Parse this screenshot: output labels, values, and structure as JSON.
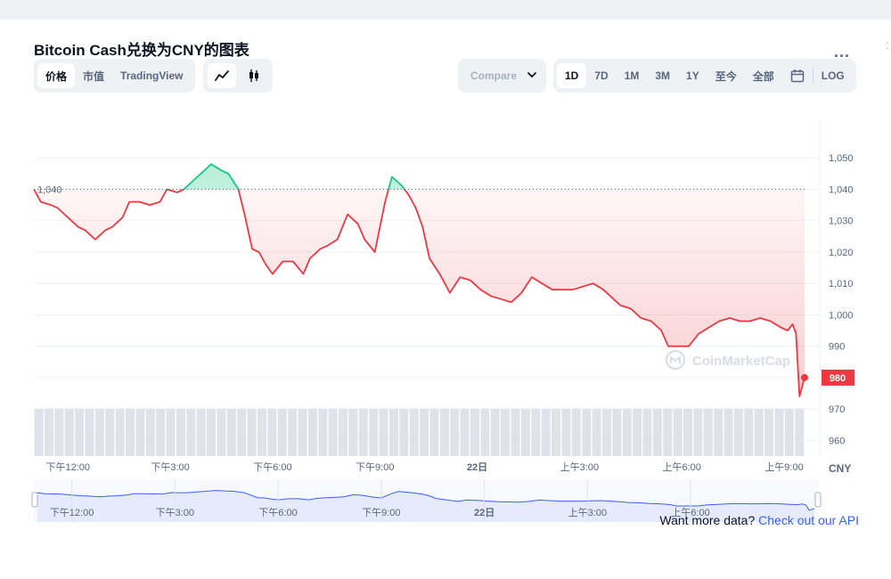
{
  "header": {
    "title": "Bitcoin Cash兑换为CNY的图表",
    "more_label": "..."
  },
  "view_tabs": [
    {
      "label": "价格",
      "active": true
    },
    {
      "label": "市值",
      "active": false
    },
    {
      "label": "TradingView",
      "active": false
    }
  ],
  "chart_type_icons": [
    {
      "icon": "line-chart-icon",
      "active": true
    },
    {
      "icon": "candlestick-icon",
      "active": false
    }
  ],
  "compare": {
    "label": "Compare with"
  },
  "range_tabs": [
    {
      "label": "1D",
      "active": true
    },
    {
      "label": "7D",
      "active": false
    },
    {
      "label": "1M",
      "active": false
    },
    {
      "label": "3M",
      "active": false
    },
    {
      "label": "1Y",
      "active": false
    },
    {
      "label": "至今",
      "active": false
    },
    {
      "label": "全部",
      "active": false
    },
    {
      "label": "",
      "icon": "calendar-icon",
      "active": false
    },
    {
      "label": "LOG",
      "active": false
    }
  ],
  "footer": {
    "prompt": "Want more data?",
    "link": "Check out our API"
  },
  "watermark": "CoinMarketCap",
  "colors": {
    "up": "#16c784",
    "down": "#ea3943",
    "navigator_fill": "#e6ebfb",
    "navigator_line": "#3861fb"
  },
  "chart_data": {
    "type": "line",
    "baseline": 1040,
    "baseline_label": "1,040",
    "current_value": 980,
    "current_label": "980",
    "currency": "CNY",
    "ylim": [
      955,
      1060
    ],
    "y_ticks": [
      {
        "value": 1050,
        "label": "1,050"
      },
      {
        "value": 1040,
        "label": "1,040"
      },
      {
        "value": 1030,
        "label": "1,030"
      },
      {
        "value": 1020,
        "label": "1,020"
      },
      {
        "value": 1010,
        "label": "1,010"
      },
      {
        "value": 1000,
        "label": "1,000"
      },
      {
        "value": 990,
        "label": "990"
      },
      {
        "value": 980,
        "label": "980"
      },
      {
        "value": 970,
        "label": "970"
      },
      {
        "value": 960,
        "label": "960"
      }
    ],
    "xlim": [
      11,
      33.6
    ],
    "x_ticks": [
      {
        "value": 12,
        "label": "下午12:00"
      },
      {
        "value": 15,
        "label": "下午3:00"
      },
      {
        "value": 18,
        "label": "下午6:00"
      },
      {
        "value": 21,
        "label": "下午9:00"
      },
      {
        "value": 24,
        "label": "22日"
      },
      {
        "value": 27,
        "label": "上午3:00"
      },
      {
        "value": 30,
        "label": "上午6:00"
      },
      {
        "value": 33,
        "label": "上午9:00"
      }
    ],
    "nav_ticks": [
      {
        "value": 12,
        "label": "下午12:00"
      },
      {
        "value": 15,
        "label": "下午3:00"
      },
      {
        "value": 18,
        "label": "下午6:00"
      },
      {
        "value": 21,
        "label": "下午9:00"
      },
      {
        "value": 24,
        "label": "22日"
      },
      {
        "value": 27,
        "label": "上午3:00"
      },
      {
        "value": 30,
        "label": "上午6:00"
      }
    ],
    "series": [
      {
        "x": [
          11.0,
          11.2,
          11.5,
          11.7,
          12.0,
          12.3,
          12.5,
          12.8,
          13.1,
          13.3,
          13.6,
          13.8,
          14.1,
          14.4,
          14.7,
          14.9,
          15.2,
          15.4,
          15.6,
          15.9,
          16.2,
          16.5,
          16.7,
          17.0,
          17.2,
          17.4,
          17.6,
          17.8,
          18.0,
          18.3,
          18.6,
          18.9,
          19.1,
          19.4,
          19.6,
          19.9,
          20.2,
          20.5,
          20.7,
          21.0,
          21.3,
          21.5,
          21.8,
          22.0,
          22.2,
          22.4,
          22.6,
          22.9,
          23.2,
          23.5,
          23.8,
          24.1,
          24.4,
          24.7,
          25.0,
          25.3,
          25.6,
          25.9,
          26.2,
          26.5,
          26.8,
          27.1,
          27.4,
          27.7,
          27.9,
          28.2,
          28.5,
          28.8,
          29.1,
          29.4,
          29.6,
          29.9,
          30.2,
          30.5,
          30.8,
          31.1,
          31.4,
          31.7,
          32.0,
          32.3,
          32.6,
          32.9,
          33.1,
          33.25,
          33.35,
          33.45,
          33.6
        ],
        "y": [
          1040,
          1036,
          1035,
          1034,
          1031,
          1028,
          1027,
          1024,
          1027,
          1028,
          1031,
          1036,
          1036,
          1035,
          1036,
          1040,
          1039,
          1040,
          1042,
          1045,
          1048,
          1046,
          1045,
          1040,
          1031,
          1021,
          1020,
          1016,
          1013,
          1017,
          1017,
          1013,
          1018,
          1021,
          1022,
          1024,
          1032,
          1029,
          1024,
          1020,
          1036,
          1044,
          1041,
          1038,
          1034,
          1028,
          1018,
          1013,
          1007,
          1012,
          1011,
          1008,
          1006,
          1005,
          1004,
          1007,
          1012,
          1010,
          1008,
          1008,
          1008,
          1009,
          1010,
          1008,
          1006,
          1003,
          1002,
          999,
          998,
          995,
          990,
          990,
          990,
          994,
          996,
          998,
          999,
          998,
          998,
          999,
          998,
          996,
          995,
          997,
          994,
          974,
          980
        ]
      }
    ],
    "volume": {
      "count": 76
    }
  }
}
